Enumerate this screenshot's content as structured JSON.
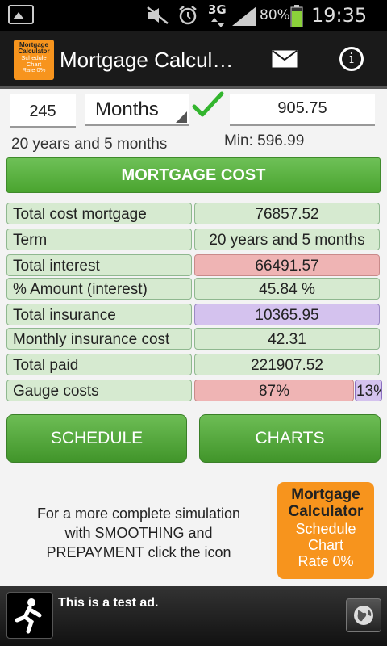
{
  "status_bar": {
    "network": "3G",
    "battery": "80%",
    "time": "19:35"
  },
  "app_bar": {
    "title": "Mortgage Calcul…",
    "logo_lines": [
      "Mortgage",
      "Calculator",
      "Schedule",
      "Chart",
      "Rate 0%"
    ]
  },
  "inputs": {
    "months_value": "245",
    "unit": "Months",
    "payment_value": "905.75"
  },
  "summary": {
    "duration_text": "20 years and 5 months",
    "min_text": "Min: 596.99"
  },
  "section_header": "MORTGAGE COST",
  "rows": [
    {
      "label": "Total cost mortgage",
      "value": "76857.52"
    },
    {
      "label": "Term",
      "value": "20 years and 5 months"
    },
    {
      "label": "Total interest",
      "value": "66491.57"
    },
    {
      "label": "% Amount (interest)",
      "value": "45.84 %"
    },
    {
      "label": "Total insurance",
      "value": "10365.95"
    },
    {
      "label": "Monthly insurance cost",
      "value": "42.31"
    },
    {
      "label": "Total paid",
      "value": "221907.52"
    },
    {
      "label": "Gauge costs",
      "value": "87%",
      "value2": "13%"
    }
  ],
  "buttons": {
    "schedule": "SCHEDULE",
    "charts": "CHARTS"
  },
  "promo": {
    "line1": "For a more complete simulation",
    "line2": "with SMOOTHING and",
    "line3": "PREPAYMENT click the icon",
    "logo_lines": [
      "Mortgage",
      "Calculator",
      "Schedule",
      "Chart",
      "Rate 0%"
    ]
  },
  "ad": {
    "text": "This is a test ad."
  },
  "colors": {
    "green": "#4aa42f",
    "row_green": "#d6ead0",
    "interest_red": "#efb4b4",
    "insurance_purple": "#d4c2ee",
    "logo_orange": "#f7941d"
  }
}
